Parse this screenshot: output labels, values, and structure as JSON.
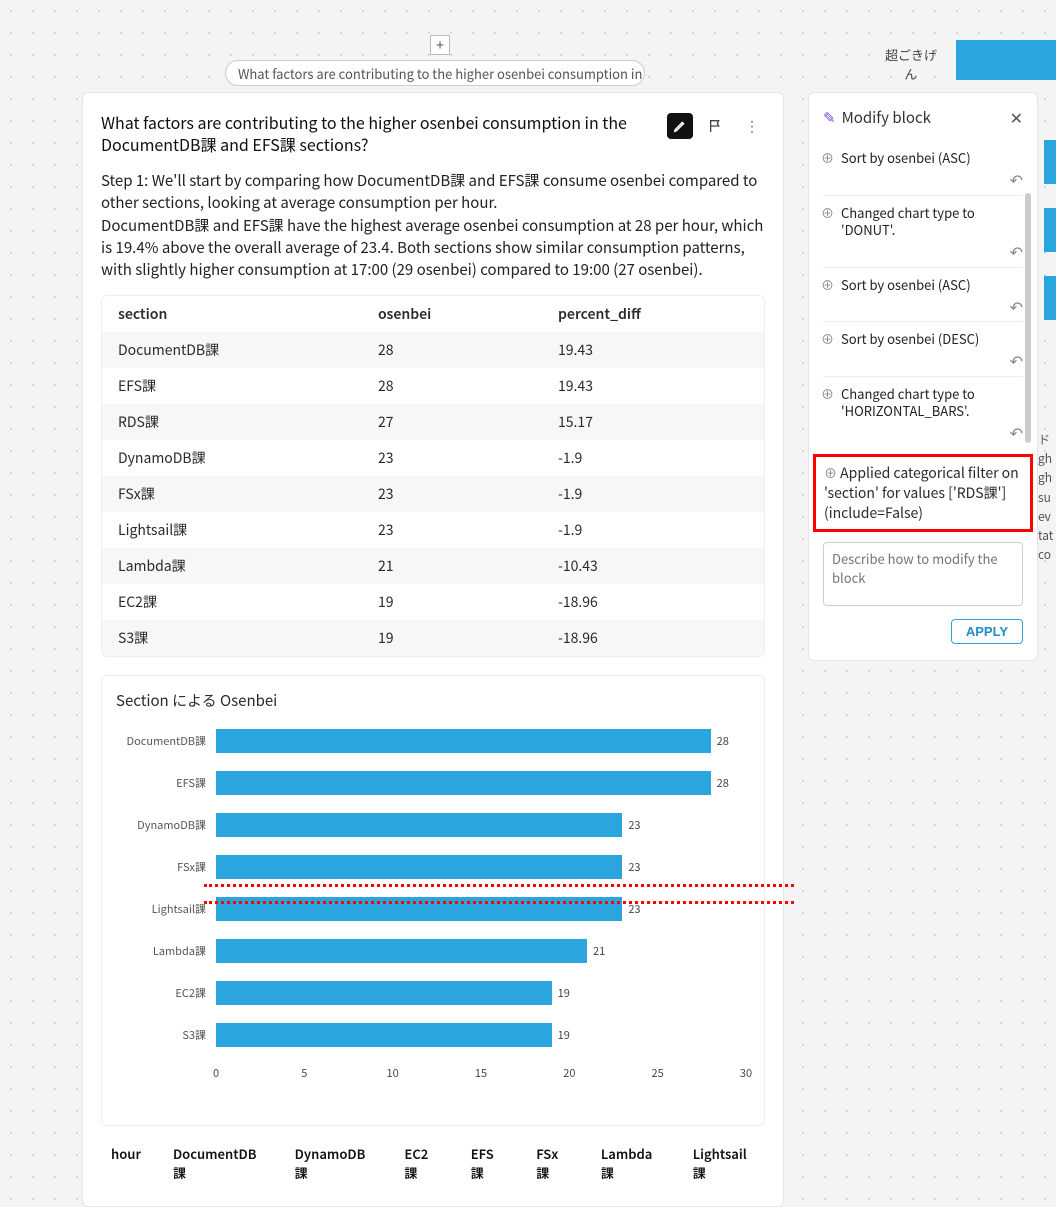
{
  "top": {
    "pill_text": "What factors are contributing to the higher osenbei consumption in…",
    "side_label": "超ごきげん"
  },
  "card": {
    "title": "What factors are contributing to the higher osenbei consumption in the DocumentDB課 and EFS課 sections?",
    "step_text": "Step 1: We'll start by comparing how DocumentDB課 and EFS課 consume osenbei compared to other sections, looking at average consumption per hour.",
    "body_text": "DocumentDB課 and EFS課 have the highest average osenbei consumption at 28 per hour, which is 19.4% above the overall average of 23.4. Both sections show similar consumption patterns, with slightly higher consumption at 17:00 (29 osenbei) compared to 19:00 (27 osenbei).",
    "table": {
      "headers": {
        "c1": "section",
        "c2": "osenbei",
        "c3": "percent_diff"
      },
      "rows": [
        {
          "c1": "DocumentDB課",
          "c2": "28",
          "c3": "19.43"
        },
        {
          "c1": "EFS課",
          "c2": "28",
          "c3": "19.43"
        },
        {
          "c1": "RDS課",
          "c2": "27",
          "c3": "15.17"
        },
        {
          "c1": "DynamoDB課",
          "c2": "23",
          "c3": "-1.9"
        },
        {
          "c1": "FSx課",
          "c2": "23",
          "c3": "-1.9"
        },
        {
          "c1": "Lightsail課",
          "c2": "23",
          "c3": "-1.9"
        },
        {
          "c1": "Lambda課",
          "c2": "21",
          "c3": "-10.43"
        },
        {
          "c1": "EC2課",
          "c2": "19",
          "c3": "-18.96"
        },
        {
          "c1": "S3課",
          "c2": "19",
          "c3": "-18.96"
        }
      ]
    },
    "legend": [
      "hour",
      "DocumentDB課",
      "DynamoDB課",
      "EC2課",
      "EFS課",
      "FSx課",
      "Lambda課",
      "Lightsail課"
    ]
  },
  "chart_data": {
    "type": "bar",
    "orientation": "horizontal",
    "title": "Section による Osenbei",
    "categories": [
      "DocumentDB課",
      "EFS課",
      "DynamoDB課",
      "FSx課",
      "Lightsail課",
      "Lambda課",
      "EC2課",
      "S3課"
    ],
    "values": [
      28,
      28,
      23,
      23,
      23,
      21,
      19,
      19
    ],
    "xlim": [
      0,
      30
    ],
    "xticks": [
      0,
      5,
      10,
      15,
      20,
      25,
      30
    ],
    "xlabel": "",
    "ylabel": ""
  },
  "panel": {
    "title": "Modify block",
    "items": [
      "Sort by osenbei (ASC)",
      "Changed chart type to 'DONUT'.",
      "Sort by osenbei (ASC)",
      "Sort by osenbei (DESC)",
      "Changed chart type to 'HORIZONTAL_BARS'."
    ],
    "highlighted": "Applied categorical filter on 'section' for values ['RDS課'] (include=False)",
    "placeholder": "Describe how to modify the block",
    "apply": "APPLY"
  },
  "side_text_fragments": [
    "ド",
    "gh",
    "gh",
    "su",
    "ev",
    "tat",
    "co"
  ]
}
